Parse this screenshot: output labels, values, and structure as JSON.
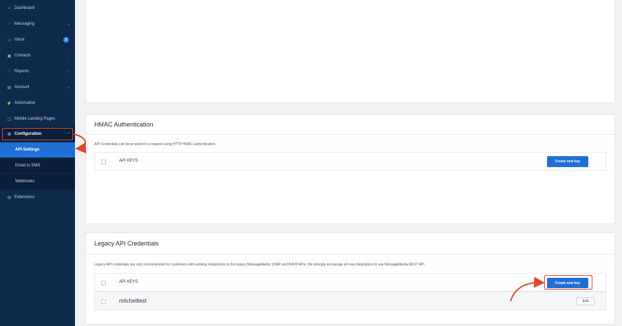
{
  "sidebar": {
    "items": [
      {
        "label": "Dashboard",
        "icon": "home-icon",
        "glyph": "⌂"
      },
      {
        "label": "Messaging",
        "icon": "chat-icon",
        "glyph": "◌"
      },
      {
        "label": "Inbox",
        "icon": "inbox-icon",
        "glyph": "▭",
        "badge": "2"
      },
      {
        "label": "Contacts",
        "icon": "contacts-icon",
        "glyph": "▣"
      },
      {
        "label": "Reports",
        "icon": "reports-icon",
        "glyph": "⫶"
      },
      {
        "label": "Account",
        "icon": "account-icon",
        "glyph": "▤"
      },
      {
        "label": "Automation",
        "icon": "automation-icon",
        "glyph": "⚡"
      },
      {
        "label": "Mobile Landing Pages",
        "icon": "mobile-icon",
        "glyph": "▢"
      },
      {
        "label": "Configuration",
        "icon": "gear-icon",
        "glyph": "⚙"
      },
      {
        "label": "Extensions",
        "icon": "extensions-icon",
        "glyph": "⊞"
      }
    ],
    "config_subitems": [
      "API Settings",
      "Email to SMS",
      "Webhooks"
    ]
  },
  "hmac": {
    "title": "HMAC Authentication",
    "description": "API Credentials can be provided in a request using HTTP HMAC authentication.",
    "header_label": "API KEYS",
    "create_button": "Create new key"
  },
  "legacy": {
    "title": "Legacy API Credentials",
    "description": "Legacy API credentials are only recommended for customers with existing integrations to the legacy MessageMedia SOAP and M4U0 APIs. We strongly encourage all new integrations to use MessageMedia REST API.",
    "header_label": "API KEYS",
    "create_button": "Create new key",
    "rows": [
      {
        "name": "mitchelltest",
        "edit_label": "Edit"
      }
    ]
  },
  "colors": {
    "sidebar": "#0d2a4d",
    "accent": "#1f6fd6",
    "annotation": "#e1472b"
  }
}
